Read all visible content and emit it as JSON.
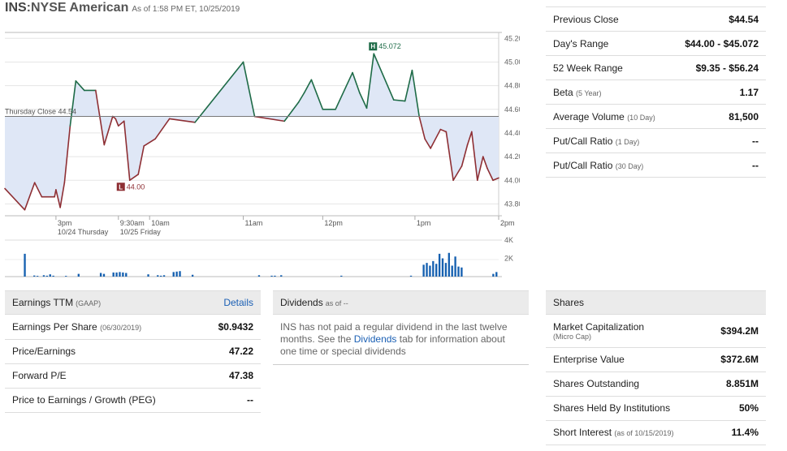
{
  "header": {
    "symbol": "INS",
    "exchange": ":NYSE American",
    "as_of": "As of 1:58 PM ET, 10/25/2019"
  },
  "quote_stats": [
    {
      "label": "Previous Close",
      "sub": "",
      "value": "$44.54"
    },
    {
      "label": "Day's Range",
      "sub": "",
      "value": "$44.00 - $45.072"
    },
    {
      "label": "52 Week Range",
      "sub": "",
      "value": "$9.35 - $56.24"
    },
    {
      "label": "Beta",
      "sub": "(5 Year)",
      "value": "1.17"
    },
    {
      "label": "Average Volume",
      "sub": "(10 Day)",
      "value": "81,500"
    },
    {
      "label": "Put/Call Ratio",
      "sub": "(1 Day)",
      "value": "--"
    },
    {
      "label": "Put/Call Ratio",
      "sub": "(30 Day)",
      "value": "--"
    }
  ],
  "chart_data": {
    "type": "line",
    "prev_close_label": "Thursday Close 44.54",
    "prev_close": 44.54,
    "high_label": "45.072",
    "low_label": "44.00",
    "high_badge": "H",
    "low_badge": "L",
    "ylim": [
      43.7,
      45.25
    ],
    "y_ticks": [
      "45.20",
      "45.00",
      "44.80",
      "44.60",
      "44.40",
      "44.20",
      "44.00",
      "43.80"
    ],
    "x_ticks": [
      {
        "label": "3pm",
        "sub": "10/24 Thursday"
      },
      {
        "label": "9:30am",
        "sub": "10/25 Friday"
      },
      {
        "label": "10am",
        "sub": ""
      },
      {
        "label": "11am",
        "sub": ""
      },
      {
        "label": "12pm",
        "sub": ""
      },
      {
        "label": "1pm",
        "sub": ""
      },
      {
        "label": "2pm",
        "sub": ""
      }
    ],
    "x": [
      "14:14",
      "14:28",
      "14:35",
      "14:40",
      "14:49",
      "14:50",
      "14:53",
      "14:56",
      "15:00",
      "15:04",
      "15:10",
      "15:18",
      "15:24",
      "15:30",
      "15:32",
      "15:34",
      "15:38",
      "15:42",
      "15:48",
      "15:52",
      "16:00",
      "16:10",
      "16:28",
      "17:02",
      "17:10",
      "17:31",
      "17:41",
      "17:45",
      "17:50",
      "17:58",
      "18:07",
      "18:19",
      "18:24",
      "18:29",
      "18:34",
      "18:48",
      "18:56",
      "19:01",
      "19:06",
      "19:10",
      "19:14",
      "19:21",
      "19:25",
      "19:30",
      "19:36",
      "19:40",
      "19:43",
      "19:47",
      "19:51",
      "19:54",
      "19:58",
      "20:02"
    ],
    "values": [
      43.93,
      43.75,
      43.98,
      43.86,
      43.86,
      43.92,
      43.77,
      43.98,
      44.46,
      44.84,
      44.76,
      44.76,
      44.3,
      44.54,
      44.52,
      44.46,
      44.5,
      44.0,
      44.05,
      44.29,
      44.35,
      44.52,
      44.49,
      45.0,
      44.54,
      44.5,
      44.66,
      44.74,
      44.85,
      44.6,
      44.6,
      44.91,
      44.74,
      44.61,
      45.07,
      44.68,
      44.67,
      44.93,
      44.54,
      44.35,
      44.27,
      44.43,
      44.41,
      44.0,
      44.12,
      44.3,
      44.41,
      44.0,
      44.2,
      44.1,
      44.0,
      44.02
    ],
    "volume_ticks": [
      "4K",
      "2K"
    ],
    "volume_max": 4000,
    "volume": [
      0,
      0,
      0,
      0,
      0,
      0,
      2500,
      0,
      0,
      120,
      80,
      0,
      150,
      100,
      250,
      100,
      0,
      0,
      0,
      80,
      0,
      0,
      0,
      300,
      0,
      0,
      0,
      0,
      0,
      0,
      400,
      300,
      0,
      0,
      450,
      450,
      500,
      450,
      400,
      0,
      0,
      0,
      0,
      0,
      0,
      250,
      0,
      0,
      150,
      100,
      150,
      0,
      0,
      500,
      550,
      600,
      0,
      0,
      0,
      200,
      0,
      0,
      0,
      0,
      0,
      0,
      0,
      0,
      0,
      0,
      0,
      0,
      0,
      0,
      0,
      0,
      0,
      0,
      0,
      0,
      150,
      0,
      0,
      0,
      100,
      100,
      0,
      150,
      0,
      0,
      0,
      0,
      0,
      0,
      0,
      0,
      0,
      0,
      0,
      0,
      0,
      0,
      0,
      0,
      0,
      0,
      100,
      0,
      0,
      0,
      0,
      0,
      0,
      0,
      0,
      0,
      0,
      0,
      0,
      0,
      0,
      0,
      0,
      0,
      0,
      0,
      0,
      0,
      100,
      0,
      0,
      0,
      1300,
      1500,
      1200,
      1700,
      1400,
      2500,
      2000,
      1500,
      2600,
      1200,
      2200,
      1100,
      1000,
      0,
      0,
      0,
      0,
      0,
      0,
      0,
      0,
      0,
      300,
      500
    ]
  },
  "earnings": {
    "title": "Earnings TTM",
    "title_sub": "(GAAP)",
    "details": "Details",
    "rows": [
      {
        "label": "Earnings Per Share",
        "sub": "(06/30/2019)",
        "value": "$0.9432"
      },
      {
        "label": "Price/Earnings",
        "sub": "",
        "value": "47.22"
      },
      {
        "label": "Forward P/E",
        "sub": "",
        "value": "47.38"
      },
      {
        "label": "Price to Earnings / Growth (PEG)",
        "sub": "",
        "value": "--"
      }
    ]
  },
  "dividends": {
    "title": "Dividends",
    "title_sub": "as of --",
    "text_pre": "INS has not paid a regular dividend in the last twelve months. See the ",
    "link": "Dividends",
    "text_post": " tab for information about one time or special dividends"
  },
  "shares": {
    "title": "Shares",
    "rows": [
      {
        "label": "Market Capitalization",
        "sub": "(Micro Cap)",
        "value": "$394.2M"
      },
      {
        "label": "Enterprise Value",
        "sub": "",
        "value": "$372.6M"
      },
      {
        "label": "Shares Outstanding",
        "sub": "",
        "value": "8.851M"
      },
      {
        "label": "Shares Held By Institutions",
        "sub": "",
        "value": "50%"
      },
      {
        "label": "Short Interest",
        "sub": "(as of 10/15/2019)",
        "value": "11.4%"
      }
    ]
  },
  "colors": {
    "up": "#1e6b47",
    "down": "#8e2f34",
    "fill": "#dfe7f6",
    "volume": "#1560b0",
    "prev_close": "#777777"
  }
}
